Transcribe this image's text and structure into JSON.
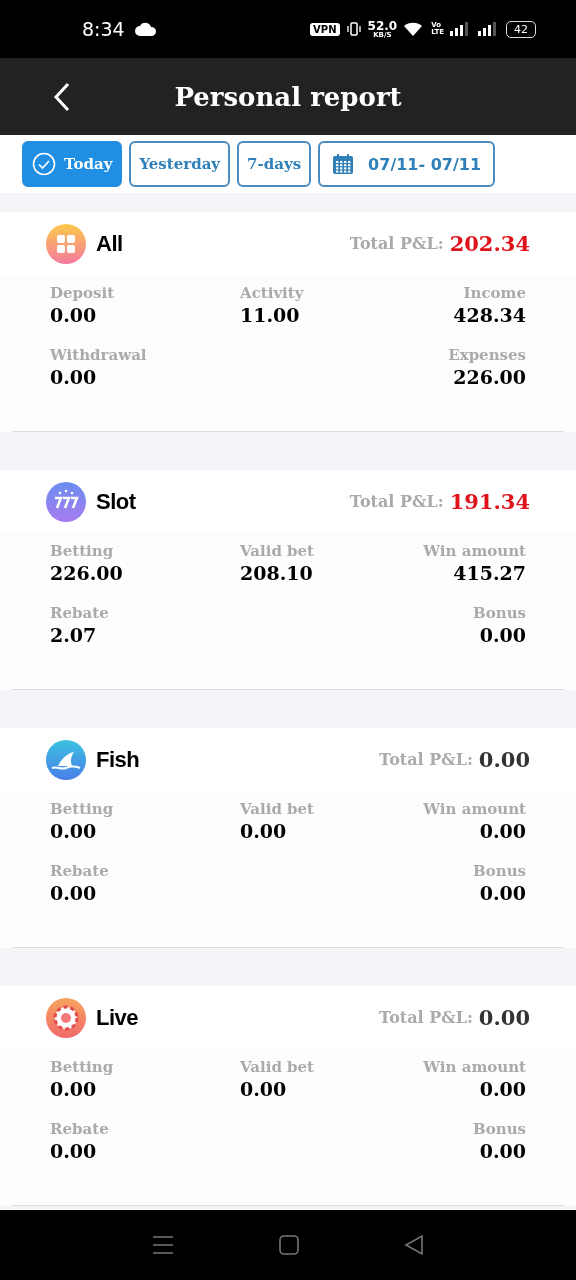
{
  "status_bar": {
    "time": "8:34",
    "vpn": "VPN",
    "speed": "52.0",
    "speed_unit": "KB/S",
    "volte_top": "Vo",
    "volte_bottom": "LTE",
    "battery": "42"
  },
  "header": {
    "title": "Personal report"
  },
  "filters": [
    {
      "label": "Today",
      "selected": true,
      "kind": "check"
    },
    {
      "label": "Yesterday",
      "selected": false,
      "kind": "plain"
    },
    {
      "label": "7-days",
      "selected": false,
      "kind": "plain"
    },
    {
      "label": "07/11- 07/11",
      "selected": false,
      "kind": "calendar"
    }
  ],
  "sections": [
    {
      "name": "All",
      "kind": "grid",
      "total_label": "Total P&L:",
      "total": "202.34",
      "highlight": true,
      "rows": [
        [
          {
            "label": "Deposit",
            "value": "0.00"
          },
          {
            "label": "Activity",
            "value": "11.00"
          },
          {
            "label": "Income",
            "value": "428.34"
          }
        ],
        [
          {
            "label": "Withdrawal",
            "value": "0.00"
          },
          "",
          {
            "label": "Expenses",
            "value": "226.00"
          }
        ]
      ]
    },
    {
      "name": "Slot",
      "kind": "slot",
      "total_label": "Total P&L:",
      "total": "191.34",
      "highlight": true,
      "rows": [
        [
          {
            "label": "Betting",
            "value": "226.00"
          },
          {
            "label": "Valid bet",
            "value": "208.10"
          },
          {
            "label": "Win amount",
            "value": "415.27"
          }
        ],
        [
          {
            "label": "Rebate",
            "value": "2.07"
          },
          "",
          {
            "label": "Bonus",
            "value": "0.00"
          }
        ]
      ]
    },
    {
      "name": "Fish",
      "kind": "fish",
      "total_label": "Total P&L:",
      "total": "0.00",
      "highlight": false,
      "rows": [
        [
          {
            "label": "Betting",
            "value": "0.00"
          },
          {
            "label": "Valid bet",
            "value": "0.00"
          },
          {
            "label": "Win amount",
            "value": "0.00"
          }
        ],
        [
          {
            "label": "Rebate",
            "value": "0.00"
          },
          "",
          {
            "label": "Bonus",
            "value": "0.00"
          }
        ]
      ]
    },
    {
      "name": "Live",
      "kind": "chip",
      "total_label": "Total P&L:",
      "total": "0.00",
      "highlight": false,
      "rows": [
        [
          {
            "label": "Betting",
            "value": "0.00"
          },
          {
            "label": "Valid bet",
            "value": "0.00"
          },
          {
            "label": "Win amount",
            "value": "0.00"
          }
        ],
        [
          {
            "label": "Rebate",
            "value": "0.00"
          },
          "",
          {
            "label": "Bonus",
            "value": "0.00"
          }
        ]
      ]
    }
  ]
}
